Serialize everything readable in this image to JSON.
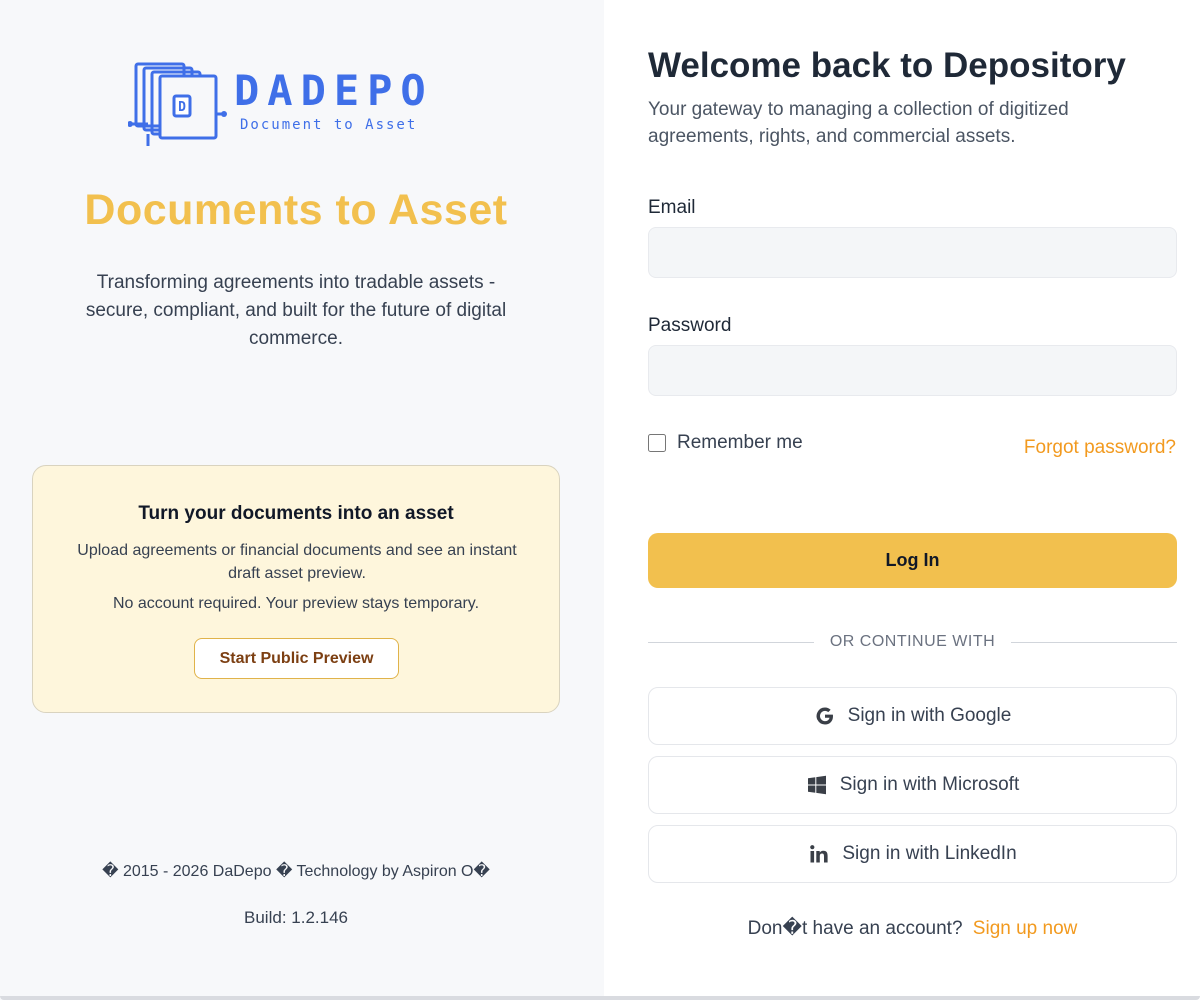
{
  "brand": {
    "name": "DADEPO",
    "tagline": "Document to Asset",
    "logo_mark_letter": "D",
    "accent_color": "#3f6fe8",
    "highlight_color": "#f2c04e",
    "link_color": "#f29a1f"
  },
  "hero": {
    "title": "Documents to Asset",
    "subtitle": "Transforming agreements into tradable assets - secure, compliant, and built for the future of digital commerce."
  },
  "preview_card": {
    "title": "Turn your documents into an asset",
    "description": "Upload agreements or financial documents and see an instant draft asset preview.",
    "note": "No account required. Your preview stays temporary.",
    "button_label": "Start Public Preview"
  },
  "footer": {
    "copyright": "� 2015 - 2026 DaDepo � Technology by Aspiron O�",
    "build": "Build: 1.2.146"
  },
  "login": {
    "title": "Welcome back to Depository",
    "subtitle": "Your gateway to managing a collection of digitized agreements, rights, and commercial assets.",
    "email_label": "Email",
    "email_value": "",
    "password_label": "Password",
    "password_value": "",
    "remember_label": "Remember me",
    "remember_checked": false,
    "forgot_label": "Forgot password?",
    "login_button": "Log In",
    "divider_text": "OR CONTINUE WITH",
    "sso": [
      {
        "label": "Sign in with Google",
        "icon": "google-icon"
      },
      {
        "label": "Sign in with Microsoft",
        "icon": "windows-icon"
      },
      {
        "label": "Sign in with LinkedIn",
        "icon": "linkedin-icon"
      }
    ],
    "signup_prompt": "Don�t have an account?",
    "signup_link": "Sign up now"
  }
}
